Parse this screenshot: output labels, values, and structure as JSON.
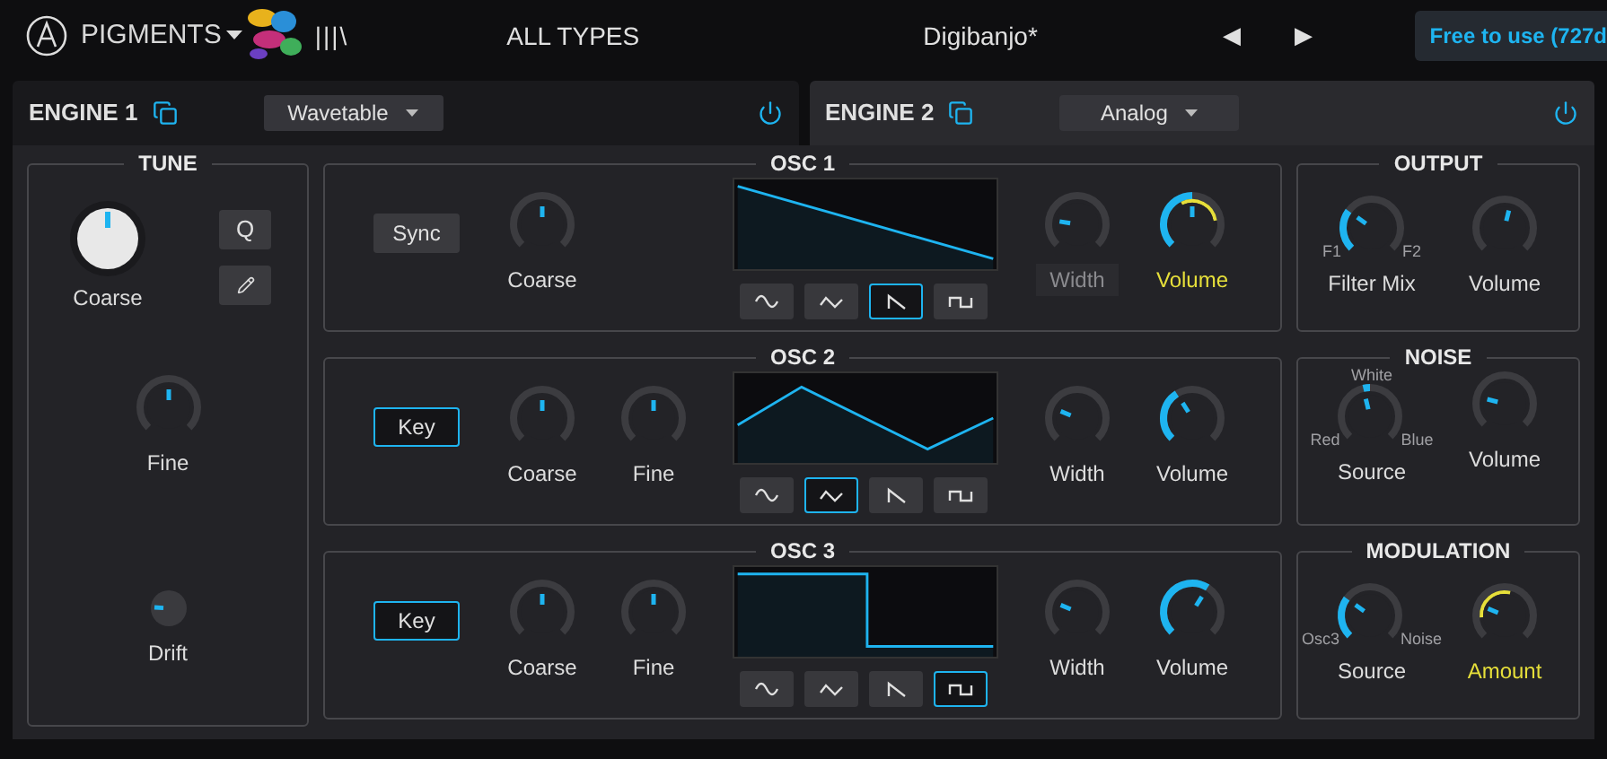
{
  "header": {
    "product": "PIGMENTS",
    "library": "|||\\",
    "category": "ALL TYPES",
    "preset": "Digibanjo*",
    "prev": "◀",
    "next": "▶",
    "license": "Free to use (727d"
  },
  "engines": [
    {
      "title": "ENGINE 1",
      "type": "Wavetable",
      "selected": true,
      "on": true
    },
    {
      "title": "ENGINE 2",
      "type": "Analog",
      "selected": false,
      "on": true
    }
  ],
  "tune": {
    "title": "TUNE",
    "button": "Q",
    "knobs": [
      {
        "label": "Coarse",
        "kind": "large",
        "level": 0.5
      },
      {
        "label": "Fine",
        "kind": "bipolar",
        "level": 0.5
      },
      {
        "label": "Drift",
        "kind": "small",
        "level": 0.18
      }
    ]
  },
  "oscillators": [
    {
      "title": "OSC 1",
      "button": {
        "label": "Sync",
        "selected": false
      },
      "knobs": [
        {
          "label": "Coarse",
          "kind": "bipolar",
          "level": 0.5
        }
      ],
      "waves": [
        {
          "kind": "sine",
          "selected": false
        },
        {
          "kind": "triangle",
          "selected": false
        },
        {
          "kind": "saw",
          "selected": true
        },
        {
          "kind": "square",
          "selected": false
        }
      ],
      "outputs": [
        {
          "label": "Width",
          "kind": "plain",
          "level": 0.2,
          "disabled": true
        },
        {
          "label": "Volume",
          "kind": "unipolar",
          "level": 0.5,
          "modulated": true,
          "highlighted": true
        }
      ]
    },
    {
      "title": "OSC 2",
      "button": {
        "label": "Key",
        "selected": true
      },
      "knobs": [
        {
          "label": "Coarse",
          "kind": "bipolar",
          "level": 0.5
        },
        {
          "label": "Fine",
          "kind": "bipolar",
          "level": 0.5
        }
      ],
      "waves": [
        {
          "kind": "sine",
          "selected": false
        },
        {
          "kind": "triangle",
          "selected": true
        },
        {
          "kind": "saw",
          "selected": false
        },
        {
          "kind": "square",
          "selected": false
        }
      ],
      "outputs": [
        {
          "label": "Width",
          "kind": "plain",
          "level": 0.25
        },
        {
          "label": "Volume",
          "kind": "unipolar",
          "level": 0.38
        }
      ]
    },
    {
      "title": "OSC 3",
      "button": {
        "label": "Key",
        "selected": true
      },
      "knobs": [
        {
          "label": "Coarse",
          "kind": "bipolar",
          "level": 0.5
        },
        {
          "label": "Fine",
          "kind": "bipolar",
          "level": 0.5
        }
      ],
      "waves": [
        {
          "kind": "sine",
          "selected": false
        },
        {
          "kind": "triangle",
          "selected": false
        },
        {
          "kind": "saw",
          "selected": false
        },
        {
          "kind": "square",
          "selected": true
        }
      ],
      "outputs": [
        {
          "label": "Width",
          "kind": "plain",
          "level": 0.25
        },
        {
          "label": "Volume",
          "kind": "unipolar",
          "level": 0.62
        }
      ]
    }
  ],
  "side_panels": [
    {
      "title": "OUTPUT",
      "knobs": [
        {
          "label": "Filter Mix",
          "kind": "unipolar",
          "level": 0.3,
          "left": "F1",
          "right": "F2"
        },
        {
          "label": "Volume",
          "kind": "plain",
          "level": 0.55
        }
      ]
    },
    {
      "title": "NOISE",
      "knobs": [
        {
          "label": "Source",
          "kind": "bipolar",
          "level": 0.45,
          "top": "White",
          "left": "Red",
          "right": "Blue"
        },
        {
          "label": "Volume",
          "kind": "plain",
          "level": 0.22
        }
      ]
    },
    {
      "title": "MODULATION",
      "knobs": [
        {
          "label": "Source",
          "kind": "unipolar",
          "level": 0.3,
          "left": "Osc3",
          "right": "Noise"
        },
        {
          "label": "Amount",
          "kind": "plain",
          "level": 0.25,
          "modulated": true,
          "highlighted": true
        }
      ]
    }
  ]
}
